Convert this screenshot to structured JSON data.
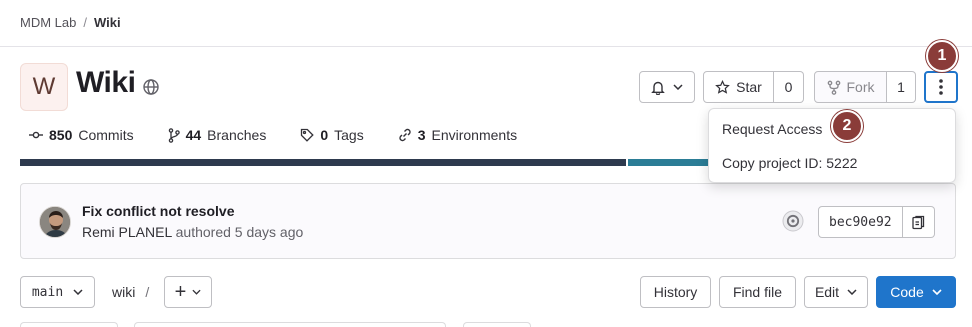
{
  "breadcrumb": {
    "group": "MDM Lab",
    "separator": "/",
    "project": "Wiki"
  },
  "project": {
    "avatar_letter": "W",
    "title": "Wiki",
    "visibility_icon": "globe-icon"
  },
  "actions": {
    "notifications_icon": "bell-icon",
    "star_label": "Star",
    "star_count": "0",
    "fork_label": "Fork",
    "fork_count": "1",
    "more_icon": "kebab-icon"
  },
  "stats": {
    "commits_count": "850",
    "commits_label": "Commits",
    "branches_count": "44",
    "branches_label": "Branches",
    "tags_count": "0",
    "tags_label": "Tags",
    "environments_count": "3",
    "environments_label": "Environments"
  },
  "language_bar": {
    "colors": [
      "#2e3a4e",
      "#2b7d96",
      "#e4e3e8"
    ]
  },
  "last_commit": {
    "title": "Fix conflict not resolve",
    "author": "Remi PLANEL",
    "meta": "authored 5 days ago",
    "sha": "bec90e92"
  },
  "dropdown": {
    "items": [
      "Request Access",
      "Copy project ID: 5222"
    ]
  },
  "annotations": {
    "badge1": "1",
    "badge2": "2"
  },
  "file_browser": {
    "branch": "main",
    "path_root": "wiki",
    "path_sep": "/",
    "add_label": "+",
    "history_label": "History",
    "find_file_label": "Find file",
    "edit_label": "Edit",
    "code_label": "Code"
  },
  "colors": {
    "accent": "#1f75cb",
    "badge": "#8a3c39"
  }
}
